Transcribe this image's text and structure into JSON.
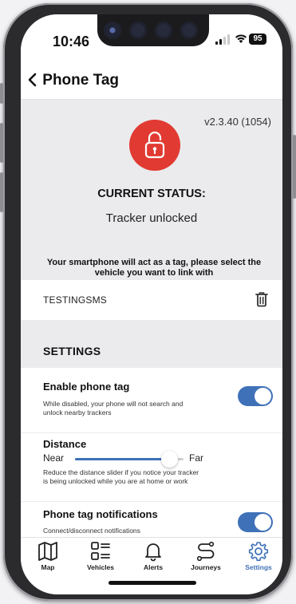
{
  "status_bar": {
    "time": "10:46",
    "battery": "95"
  },
  "header": {
    "title": "Phone Tag",
    "back_icon": "chevron-left-icon"
  },
  "status": {
    "version": "v2.3.40 (1054)",
    "lock_icon": "unlocked-padlock-icon",
    "lock_color": "#e13a32",
    "label": "CURRENT STATUS:",
    "value": "Tracker unlocked",
    "instruction": "Your smartphone will act as a tag, please select the vehicle you want to link with"
  },
  "vehicle": {
    "name": "TESTINGSMS",
    "delete_icon": "trash-icon"
  },
  "settings": {
    "title": "SETTINGS",
    "enable_phone_tag": {
      "title": "Enable phone tag",
      "description": "While disabled, your phone will not search and unlock nearby trackers",
      "enabled": true
    },
    "distance": {
      "title": "Distance",
      "min_label": "Near",
      "max_label": "Far",
      "value_fraction": 0.87,
      "description": "Reduce the distance slider if you notice your tracker is being unlocked while you are at home or work"
    },
    "notifications": {
      "title": "Phone tag notifications",
      "description": "Connect/disconnect notifications",
      "enabled": true
    }
  },
  "accent_color": "#3f71b8",
  "tabs": [
    {
      "label": "Map",
      "icon": "map-icon",
      "active": false
    },
    {
      "label": "Vehicles",
      "icon": "list-icon",
      "active": false
    },
    {
      "label": "Alerts",
      "icon": "bell-icon",
      "active": false
    },
    {
      "label": "Journeys",
      "icon": "route-icon",
      "active": false
    },
    {
      "label": "Settings",
      "icon": "gear-icon",
      "active": true
    }
  ]
}
